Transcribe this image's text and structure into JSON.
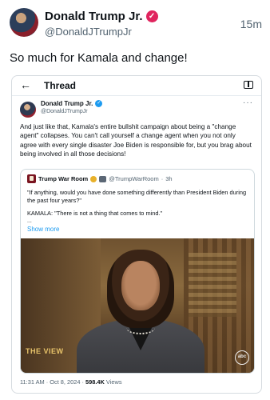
{
  "post": {
    "author_name": "Donald Trump Jr.",
    "author_handle": "@DonaldJTrumpJr",
    "time_ago": "15m",
    "text": "So much for Kamala and change!",
    "verified_glyph": "✓"
  },
  "embedded": {
    "thread_title": "Thread",
    "back_glyph": "←",
    "tweet": {
      "author_name": "Donald Trump Jr.",
      "author_handle": "@DonaldJTrumpJr",
      "more_glyph": "···",
      "verified_glyph": "✓",
      "text": "And just like that, Kamala's entire bullshit campaign about being a \"change agent\" collapses. You can't call yourself a change agent when you not only agree with every single disaster Joe Biden is responsible for, but you brag about being involved in all those decisions!"
    },
    "quote": {
      "author_name": "Trump War Room",
      "author_handle": "@TrumpWarRoom",
      "separator": "·",
      "time_ago": "3h",
      "text_1": "\"If anything, would you have done something differently than President Biden during the past four years?\"",
      "text_2": "KAMALA: \"There is not a thing that comes to mind.\"",
      "ellipsis": "...",
      "show_more": "Show more",
      "video_show_logo": "THE VIEW",
      "video_network_logo": "abc"
    },
    "footer": {
      "timestamp": "11:31 AM · Oct 8, 2024 · ",
      "views_count": "598.4K",
      "views_label": " Views"
    }
  },
  "colors": {
    "text_primary": "#0f1419",
    "text_secondary": "#536471",
    "link": "#1d9bf0",
    "outer_verified": "#e0245e",
    "inner_verified": "#1d9bf0"
  },
  "icons": [
    "arrow-left-icon",
    "reader-view-icon",
    "more-icon",
    "verified-badge-icon"
  ]
}
